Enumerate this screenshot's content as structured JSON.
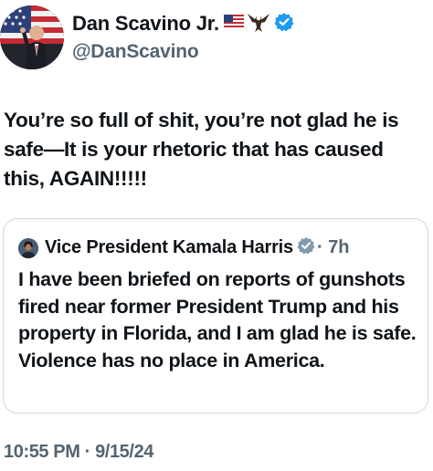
{
  "author": {
    "display_name": "Dan Scavino Jr.",
    "handle": "@DanScavino",
    "avatar_icon": "profile-photo",
    "name_emojis": [
      "us-flag-icon",
      "eagle-icon"
    ],
    "verified_color": "#1d9bf0"
  },
  "tweet": {
    "text": "You’re so full of shit, you’re not glad he is safe—It is your rhetoric that has caused this, AGAIN!!!!!",
    "timestamp": "10:55 PM · 9/15/24"
  },
  "quoted_tweet": {
    "display_name": "Vice President Kamala Harris",
    "time_ago": "· 7h",
    "badge_color": "#829aab",
    "text": "I have been briefed on reports of gunshots fired near former President Trump and his property in Florida, and I am glad he is safe. Violence has no place in America."
  },
  "colors": {
    "text_primary": "#0f1419",
    "text_secondary": "#536471",
    "border": "#cfd9de"
  }
}
